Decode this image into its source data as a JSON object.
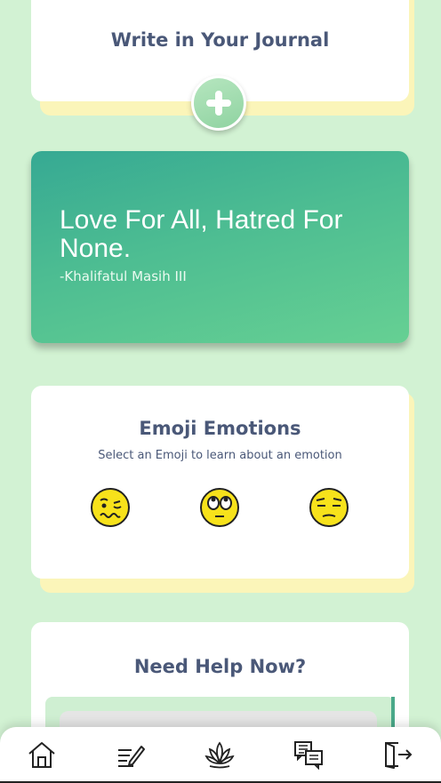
{
  "journal": {
    "title": "Write in Your Journal",
    "add_icon": "plus-icon"
  },
  "quote": {
    "text": "Love For All, Hatred For None.",
    "author": "-Khalifatul Masih III"
  },
  "emoji_emotions": {
    "title": "Emoji Emotions",
    "subtitle": "Select an Emoji to learn about an emotion",
    "emojis": [
      {
        "name": "woozy-face-icon"
      },
      {
        "name": "face-with-rolling-eyes-icon"
      },
      {
        "name": "relieved-face-icon"
      }
    ]
  },
  "help": {
    "title": "Need Help Now?"
  },
  "nav": {
    "items": [
      {
        "icon": "home-icon"
      },
      {
        "icon": "journal-icon"
      },
      {
        "icon": "lotus-icon"
      },
      {
        "icon": "chat-icon"
      },
      {
        "icon": "logout-icon"
      }
    ]
  },
  "colors": {
    "background": "#d2f2d3",
    "card_shadow": "#fbf5b9",
    "quote_gradient_start": "#36a993",
    "quote_gradient_end": "#66d093",
    "heading": "#4a5878"
  }
}
